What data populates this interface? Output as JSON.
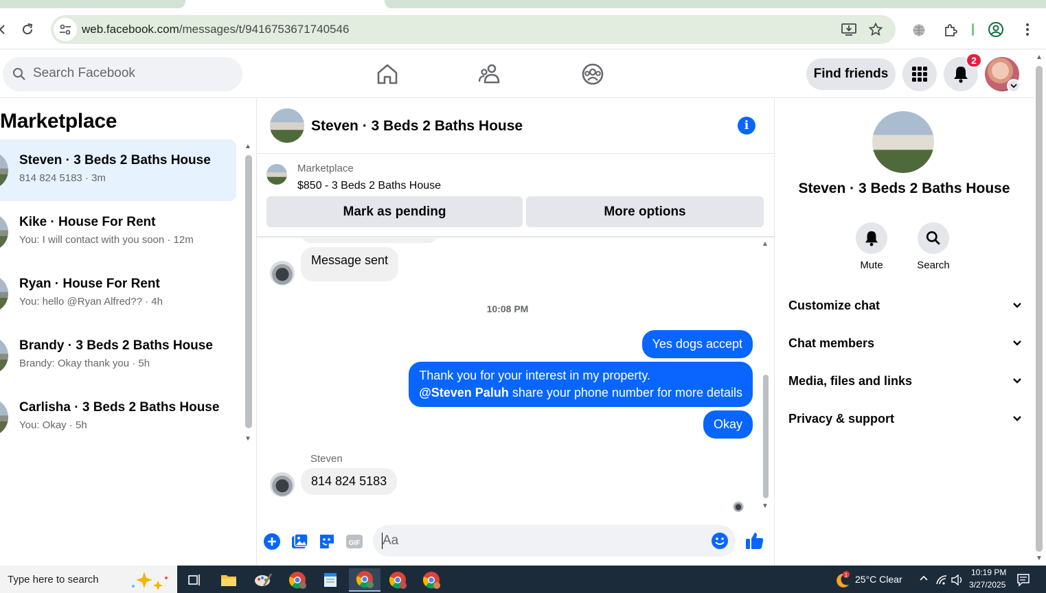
{
  "browser": {
    "url_domain": "web.facebook.com",
    "url_path": "/messages/t/9416753671740546"
  },
  "nav": {
    "search_placeholder": "Search Facebook",
    "find_friends": "Find friends",
    "notification_count": "2"
  },
  "sidebar": {
    "title": "Marketplace",
    "conversations": [
      {
        "title": "Steven · 3 Beds 2 Baths House",
        "subtitle": "814 824 5183 · 3m"
      },
      {
        "title": "Kike · House For Rent",
        "subtitle": "You: I will contact with you soon · 12m"
      },
      {
        "title": "Ryan · House For Rent",
        "subtitle": "You: hello @Ryan Alfred?? · 4h"
      },
      {
        "title": "Brandy · 3 Beds 2 Baths House",
        "subtitle": "Brandy: Okay thank you · 5h"
      },
      {
        "title": "Carlisha · 3 Beds 2 Baths House",
        "subtitle": "You: Okay · 5h"
      }
    ]
  },
  "chat": {
    "title": "Steven · 3 Beds 2 Baths House",
    "marketplace_label": "Marketplace",
    "listing": "$850 - 3 Beds 2 Baths House",
    "mark_pending": "Mark as pending",
    "more_options": "More options",
    "messages": {
      "msg_sent": "Message sent",
      "time": "10:08 PM",
      "yes_dogs": "Yes dogs accept",
      "thanks_line1": "Thank you for your interest in my property.",
      "mention": "@Steven Paluh",
      "thanks_line2_rest": " share your phone number for more details",
      "okay": "Okay",
      "sender_name": "Steven",
      "phone": "814 824 5183"
    },
    "input_placeholder": "Aa"
  },
  "info_panel": {
    "name": "Steven · 3 Beds 2 Baths House",
    "mute": "Mute",
    "search": "Search",
    "sections": [
      "Customize chat",
      "Chat members",
      "Media, files and links",
      "Privacy & support"
    ]
  },
  "taskbar": {
    "search_placeholder": "Type here to search",
    "weather": "25°C  Clear",
    "time": "10:19 PM",
    "date": "3/27/2025"
  },
  "colors": {
    "accent": "#0866ff",
    "active_conversation": "#e6f2fe",
    "badge": "#e41e3f"
  }
}
